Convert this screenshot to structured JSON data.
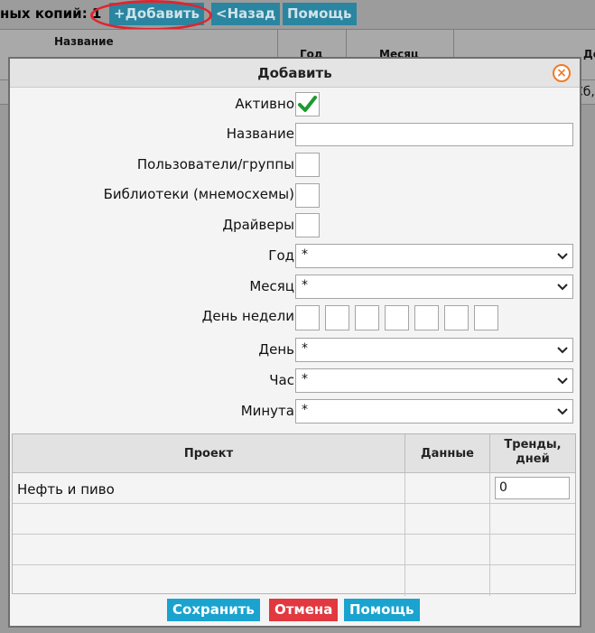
{
  "background": {
    "title": "ных копий: 1",
    "buttons": {
      "add": "+Добавить",
      "back": "<Назад",
      "help": "Помощь"
    },
    "columns": {
      "name": "Название",
      "year": "Год",
      "month": "Месяц",
      "day": "Ден"
    },
    "row_fragment": "Сб,"
  },
  "dialog": {
    "title": "Добавить",
    "labels": {
      "active": "Активно",
      "name": "Название",
      "users": "Пользователи/группы",
      "libraries": "Библиотеки (мнемосхемы)",
      "drivers": "Драйверы",
      "year": "Год",
      "month": "Месяц",
      "weekday": "День недели",
      "day": "День",
      "hour": "Час",
      "minute": "Минута"
    },
    "values": {
      "active_checked": true,
      "name": "",
      "year": "*",
      "month": "*",
      "day": "*",
      "hour": "*",
      "minute": "*"
    },
    "project_table": {
      "headers": {
        "project": "Проект",
        "data": "Данные",
        "trends": "Тренды, дней"
      },
      "rows": [
        {
          "project": "Нефть и пиво",
          "trends": "0"
        }
      ]
    },
    "buttons": {
      "save": "Сохранить",
      "cancel": "Отмена",
      "help": "Помощь"
    }
  },
  "colors": {
    "button_blue": "#1aa3cf",
    "button_red": "#e2383f",
    "check_green": "#1f9a2d",
    "highlight_red": "#e0242e",
    "close_orange": "#f07b2c"
  }
}
